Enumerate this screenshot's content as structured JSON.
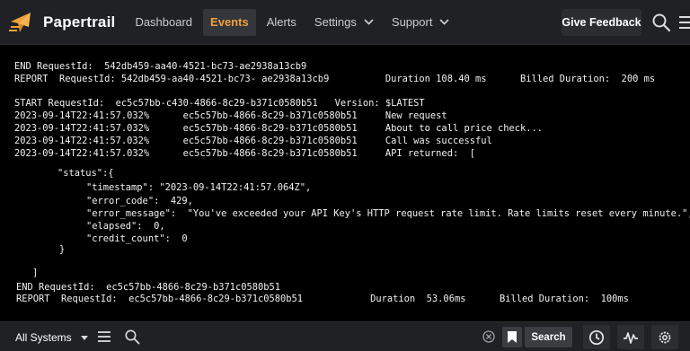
{
  "header": {
    "brand": "Papertrail",
    "nav": [
      {
        "label": "Dashboard",
        "active": false,
        "dropdown": false
      },
      {
        "label": "Events",
        "active": true,
        "dropdown": false
      },
      {
        "label": "Alerts",
        "active": false,
        "dropdown": false
      },
      {
        "label": "Settings",
        "active": false,
        "dropdown": true
      },
      {
        "label": "Support",
        "active": false,
        "dropdown": true
      }
    ],
    "feedback_label": "Give Feedback",
    "accent_color": "#f0a13a"
  },
  "log_lines": [
    "END RequestId:  542db459-aa40-4521-bc73-ae2938a13cb9",
    "REPORT  RequestId: 542db459-aa40-4521-bc73- ae2938a13cb9          Duration 108.40 ms      Billed Duration:  200 ms",
    "START RequestId:  ec5c57bb-c430-4866-8c29-b371c0580b51   Version: $LATEST",
    "2023-09-14T22:41:57.032%      ec5c57bb-4866-8c29-b371c0580b51     New request",
    "2023-09-14T22:41:57.032%      ec5c57bb-4866-8c29-b371c0580b51     About to call price check...",
    "2023-09-14T22:41:57.032%      ec5c57bb-4866-8c29-b371c0580b51     Call was successful",
    "2023-09-14T22:41:57.032%      ec5c57bb-4866-8c29-b371c0580b51     API returned:  [",
    "\"status\":{",
    "\"timestamp\": \"2023-09-14T22:41:57.064Z\",",
    "\"error_code\":  429,",
    "\"error_message\":  \"You've exceeded your API Key's HTTP request rate limit. Rate limits reset every minute.\",",
    "\"elapsed\":  0,",
    "\"credit_count\":  0",
    "}",
    "]",
    "END RequestId:  ec5c57bb-4866-8c29-b371c0580b51",
    "REPORT  RequestId:  ec5c57bb-4866-8c29-b371c0580b51            Duration  53.06ms      Billed Duration:  100ms"
  ],
  "footer": {
    "system_selector": "All Systems",
    "search_placeholder": "",
    "search_button": "Search"
  }
}
